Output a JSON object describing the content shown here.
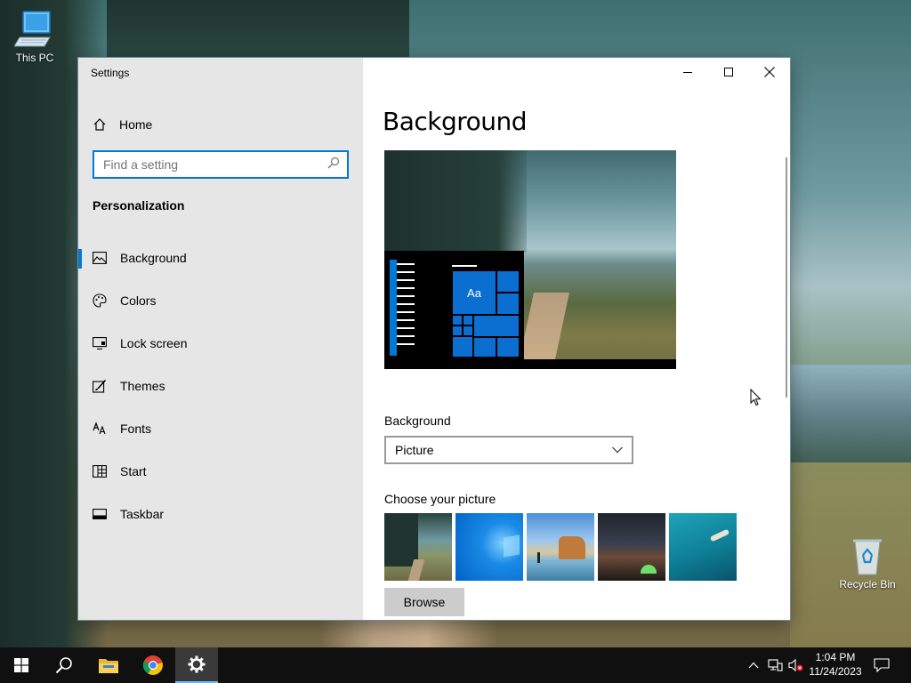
{
  "desktop": {
    "icons": [
      {
        "label": "This PC",
        "icon": "computer-icon"
      },
      {
        "label": "Recycle Bin",
        "icon": "recycle-bin-icon"
      }
    ]
  },
  "window": {
    "title": "Settings",
    "controls": {
      "minimize": "minimize-icon",
      "maximize": "maximize-icon",
      "close": "close-icon"
    }
  },
  "sidebar": {
    "home_label": "Home",
    "search": {
      "placeholder": "Find a setting"
    },
    "section_heading": "Personalization",
    "items": [
      {
        "label": "Background",
        "icon": "picture-icon",
        "active": true
      },
      {
        "label": "Colors",
        "icon": "palette-icon",
        "active": false
      },
      {
        "label": "Lock screen",
        "icon": "lock-screen-icon",
        "active": false
      },
      {
        "label": "Themes",
        "icon": "brush-icon",
        "active": false
      },
      {
        "label": "Fonts",
        "icon": "font-icon",
        "active": false
      },
      {
        "label": "Start",
        "icon": "start-icon",
        "active": false
      },
      {
        "label": "Taskbar",
        "icon": "taskbar-icon",
        "active": false
      }
    ]
  },
  "main": {
    "title": "Background",
    "preview": {
      "tile_text": "Aa"
    },
    "background_label": "Background",
    "background_value": "Picture",
    "choose_label": "Choose your picture",
    "thumbnails": [
      "forest-road",
      "windows-blue",
      "beach-rocks",
      "night-sky-tent",
      "underwater-swimmer"
    ],
    "browse_label": "Browse"
  },
  "taskbar": {
    "buttons": [
      "start-button",
      "search-button",
      "file-explorer-button",
      "chrome-button",
      "settings-button"
    ],
    "active": "settings-button",
    "time": "1:04 PM",
    "date": "11/24/2023"
  },
  "colors": {
    "accent": "#0078d7",
    "sidebar": "#e6e6e6",
    "taskbar": "#101010"
  }
}
